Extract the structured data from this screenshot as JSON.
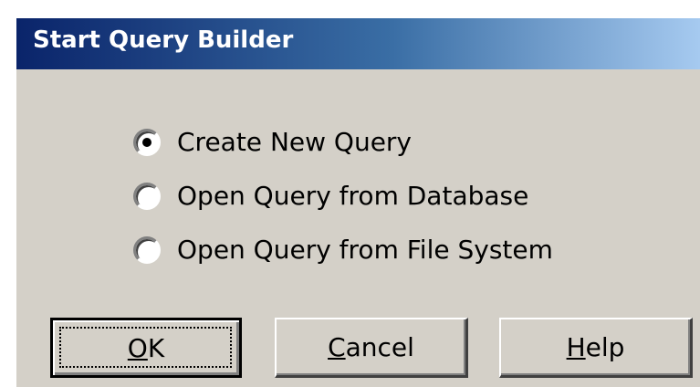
{
  "window": {
    "title": "Start Query Builder"
  },
  "options": [
    {
      "label": "Create New Query",
      "checked": true
    },
    {
      "label": "Open Query from Database",
      "checked": false
    },
    {
      "label": "Open Query from File System",
      "checked": false
    }
  ],
  "buttons": {
    "ok": {
      "mnemonic": "O",
      "rest": "K"
    },
    "cancel": {
      "mnemonic": "C",
      "rest": "ancel"
    },
    "help": {
      "mnemonic": "H",
      "rest": "elp"
    }
  },
  "colors": {
    "title_gradient_start": "#0a246a",
    "title_gradient_end": "#a6caf0",
    "face": "#d4d0c8"
  }
}
